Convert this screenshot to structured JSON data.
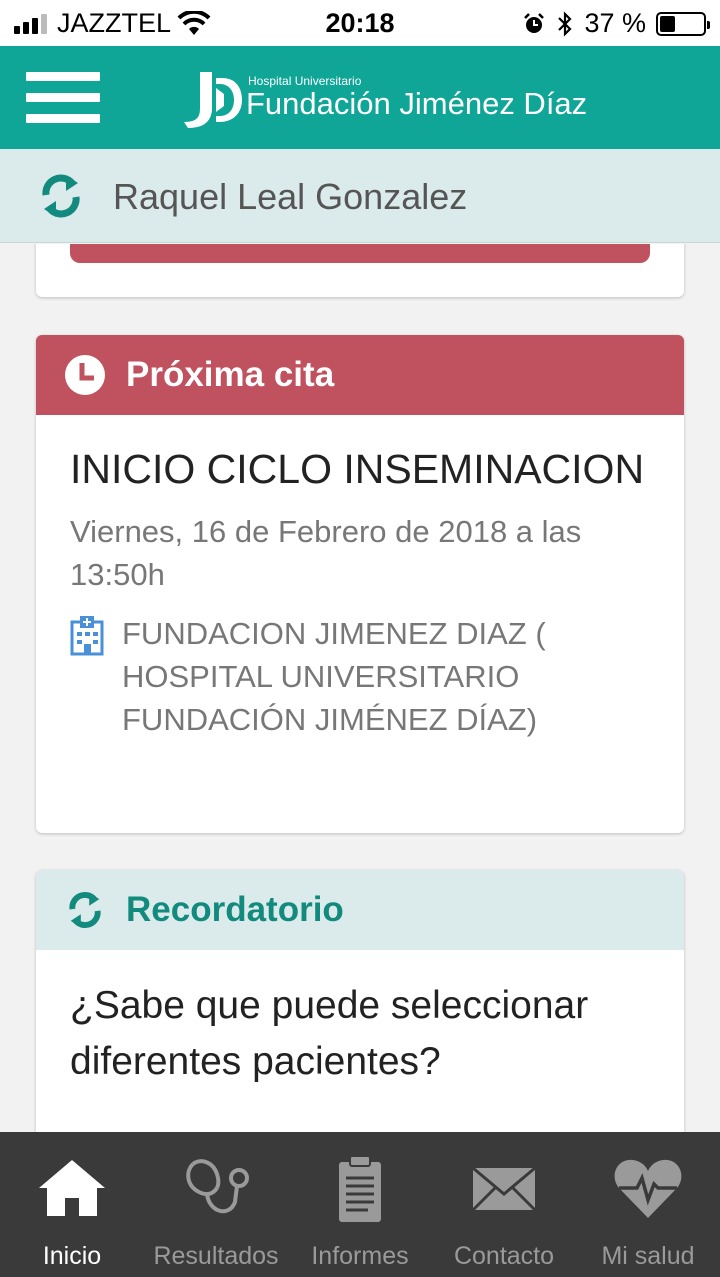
{
  "status_bar": {
    "carrier": "JAZZTEL",
    "time": "20:18",
    "battery": "37 %",
    "battery_level": 0.37
  },
  "header": {
    "logo_small": "Hospital Universitario",
    "logo_big": "Fundación Jiménez Díaz",
    "menu_icon": "hamburger-icon",
    "brand_color": "#0fa597"
  },
  "patient": {
    "name": "Raquel Leal Gonzalez",
    "icon": "sync-icon"
  },
  "next_appointment": {
    "header": "Próxima cita",
    "icon": "clock-icon",
    "title": "INICIO CICLO INSEMINACION",
    "date": "Viernes, 16 de Febrero de 2018 a las 13:50h",
    "location_icon": "hospital-icon",
    "location": "FUNDACION JIMENEZ DIAZ ( HOSPITAL UNIVERSITARIO FUNDACIÓN JIMÉNEZ DÍAZ)",
    "accent_color": "#c0515e"
  },
  "reminder": {
    "header": "Recordatorio",
    "icon": "sync-icon",
    "text": "¿Sabe que puede seleccionar diferentes pacientes?"
  },
  "bottom_nav": {
    "items": [
      {
        "label": "Inicio",
        "icon": "home-icon",
        "active": true
      },
      {
        "label": "Resultados",
        "icon": "stethoscope-icon",
        "active": false
      },
      {
        "label": "Informes",
        "icon": "clipboard-icon",
        "active": false
      },
      {
        "label": "Contacto",
        "icon": "envelope-icon",
        "active": false
      },
      {
        "label": "Mi salud",
        "icon": "heart-pulse-icon",
        "active": false
      }
    ]
  }
}
